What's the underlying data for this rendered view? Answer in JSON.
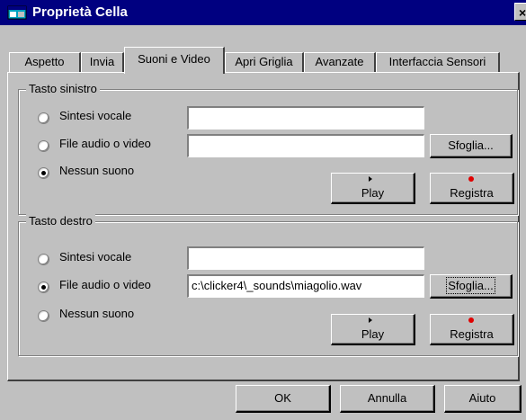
{
  "window": {
    "title": "Proprietà Cella",
    "close_glyph": "×"
  },
  "tabs": [
    {
      "label": "Aspetto"
    },
    {
      "label": "Invia"
    },
    {
      "label": "Suoni e Video",
      "active": true
    },
    {
      "label": "Apri Griglia"
    },
    {
      "label": "Avanzate"
    },
    {
      "label": "Interfaccia Sensori"
    }
  ],
  "left_key": {
    "title": "Tasto sinistro",
    "options": [
      "Sintesi vocale",
      "File audio o video",
      "Nessun suono"
    ],
    "selected": "Nessun suono",
    "speech_text": "",
    "file_path": "",
    "browse_label": "Sfoglia...",
    "play_label": "Play",
    "record_label": "Registra"
  },
  "right_key": {
    "title": "Tasto destro",
    "options": [
      "Sintesi vocale",
      "File audio o video",
      "Nessun suono"
    ],
    "selected": "File audio o video",
    "speech_text": "",
    "file_path": "c:\\clicker4\\_sounds\\miagolio.wav",
    "browse_label": "Sfoglia...",
    "play_label": "Play",
    "record_label": "Registra"
  },
  "footer": {
    "ok_label": "OK",
    "cancel_label": "Annulla",
    "help_label": "Aiuto"
  },
  "colors": {
    "titlebar": "#000080",
    "face": "#c0c0c0",
    "record_dot": "#e00000"
  },
  "icons": {
    "app": "window-app-icon",
    "play": "play-icon",
    "record": "record-icon"
  }
}
